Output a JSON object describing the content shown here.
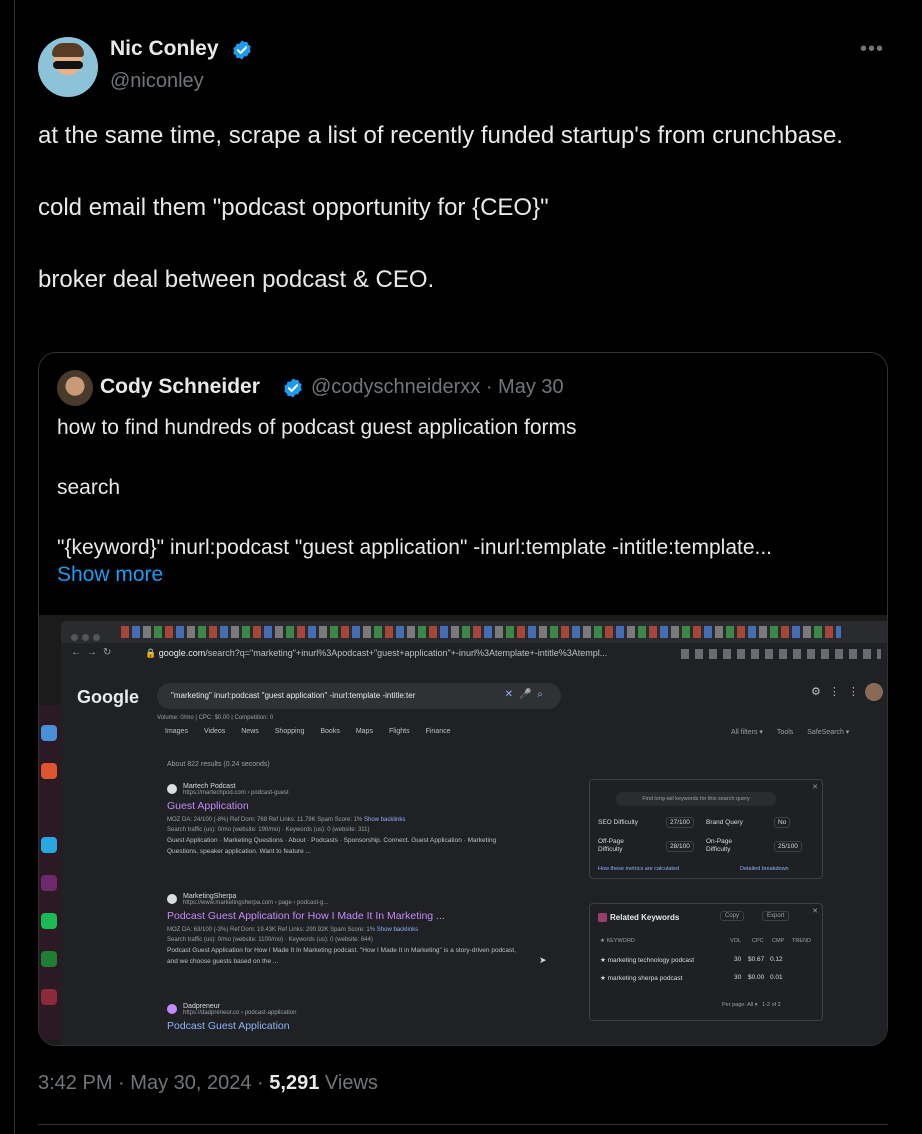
{
  "tweet": {
    "author": {
      "name": "Nic Conley",
      "handle": "@niconley",
      "verified": true
    },
    "more_icon": "more-horizontal-icon",
    "text": [
      "at the same time, scrape a list of recently funded startup's from crunchbase.",
      "cold email them \"podcast opportunity for {CEO}\"",
      "broker deal between podcast & CEO."
    ],
    "time": "3:42 PM",
    "separator": "·",
    "date": "May 30, 2024",
    "views_count": "5,291",
    "views_label": "Views"
  },
  "quote": {
    "author": {
      "name": "Cody Schneider",
      "handle": "@codyschneiderxx",
      "date": "May 30",
      "verified": true
    },
    "meta": "@codyschneiderxx · May 30",
    "text": [
      "how to find hundreds of podcast guest application forms",
      "search",
      "\"{keyword}\" inurl:podcast \"guest application\" -inurl:template -intitle:template..."
    ],
    "show_more": "Show more"
  },
  "screenshot": {
    "url_domain": "google.com",
    "url_path": "/search?q=\"marketing\"+inurl%3Apodcast+\"guest+application\"+-inurl%3Atemplate+-intitle%3Atempl...",
    "logo": "Google",
    "query": "\"marketing\" inurl:podcast \"guest application\" -inurl:template -intitle:ter",
    "volume_line": "Volume: 0/mo | CPC: $0.00 | Competition: 0",
    "tabs": [
      "Images",
      "Videos",
      "News",
      "Shopping",
      "Books",
      "Maps",
      "Flights",
      "Finance"
    ],
    "tools": [
      "All filters ▾",
      "Tools",
      "SafeSearch ▾"
    ],
    "result_count": "About 822 results (0.24 seconds)",
    "results": [
      {
        "site": "Martech Podcast",
        "url": "https://martechpod.com › podcast-guest",
        "title": "Guest Application",
        "seo": "MOZ DA: 24/100 (-8%)   Ref Dom: 768   Ref Links: 11.79K   Spam Score: 1%",
        "seo_link": "Show backlinks",
        "traffic": "Search traffic (us): 0/mo (website: 190/mo) · Keywords (us): 0 (website: 311)",
        "snippet": "Guest Application · Marketing Questions · About · Podcasts · Sponsorship. Connect. Guest Application · Marketing Questions, speaker application. Want to feature ..."
      },
      {
        "site": "MarketingSherpa",
        "url": "https://www.marketingsherpa.com › page › podcast-g...",
        "title": "Podcast Guest Application for How I Made It In Marketing ...",
        "seo": "MOZ DA: 63/100 (-3%)   Ref Dom: 19.43K   Ref Links: 290.92K   Spam Score: 1%",
        "seo_link": "Show backlinks",
        "traffic": "Search traffic (us): 0/mo (website: 1100/mo) · Keywords (us): 0 (website: 644)",
        "snippet": "Podcast Guest Application for How I Made It In Marketing podcast. \"How I Made It in Marketing\" is a story-driven podcast, and we choose guests based on the ..."
      },
      {
        "site": "Dadpreneur",
        "url": "https://dadpreneur.co › podcast-application",
        "title": "Podcast Guest Application"
      }
    ],
    "seo_panel": {
      "hint": "Find long-tail keywords for this search query",
      "seo_difficulty_label": "SEO Difficulty",
      "seo_difficulty": "27/100",
      "brand_query_label": "Brand Query",
      "brand_query": "No",
      "offpage_label_1": "Off-Page",
      "offpage_label_2": "Difficulty",
      "offpage": "28/100",
      "onpage_label_1": "On-Page",
      "onpage_label_2": "Difficulty",
      "onpage": "25/100",
      "link_how": "How these metrics are calculated",
      "link_breakdown": "Detailed breakdown"
    },
    "related_panel": {
      "title": "Related Keywords",
      "copy": "Copy",
      "export": "Export",
      "headers": [
        "KEYWORD",
        "VOL",
        "CPC",
        "CMP",
        "TREND"
      ],
      "rows": [
        {
          "keyword": "marketing technology podcast",
          "vol": "30",
          "cpc": "$0.67",
          "cmp": "0.12"
        },
        {
          "keyword": "marketing sherpa podcast",
          "vol": "30",
          "cpc": "$0.00",
          "cmp": "0.01"
        }
      ],
      "per_page_label": "Per page:",
      "per_page_value": "All",
      "range": "1-2 of 2"
    }
  }
}
